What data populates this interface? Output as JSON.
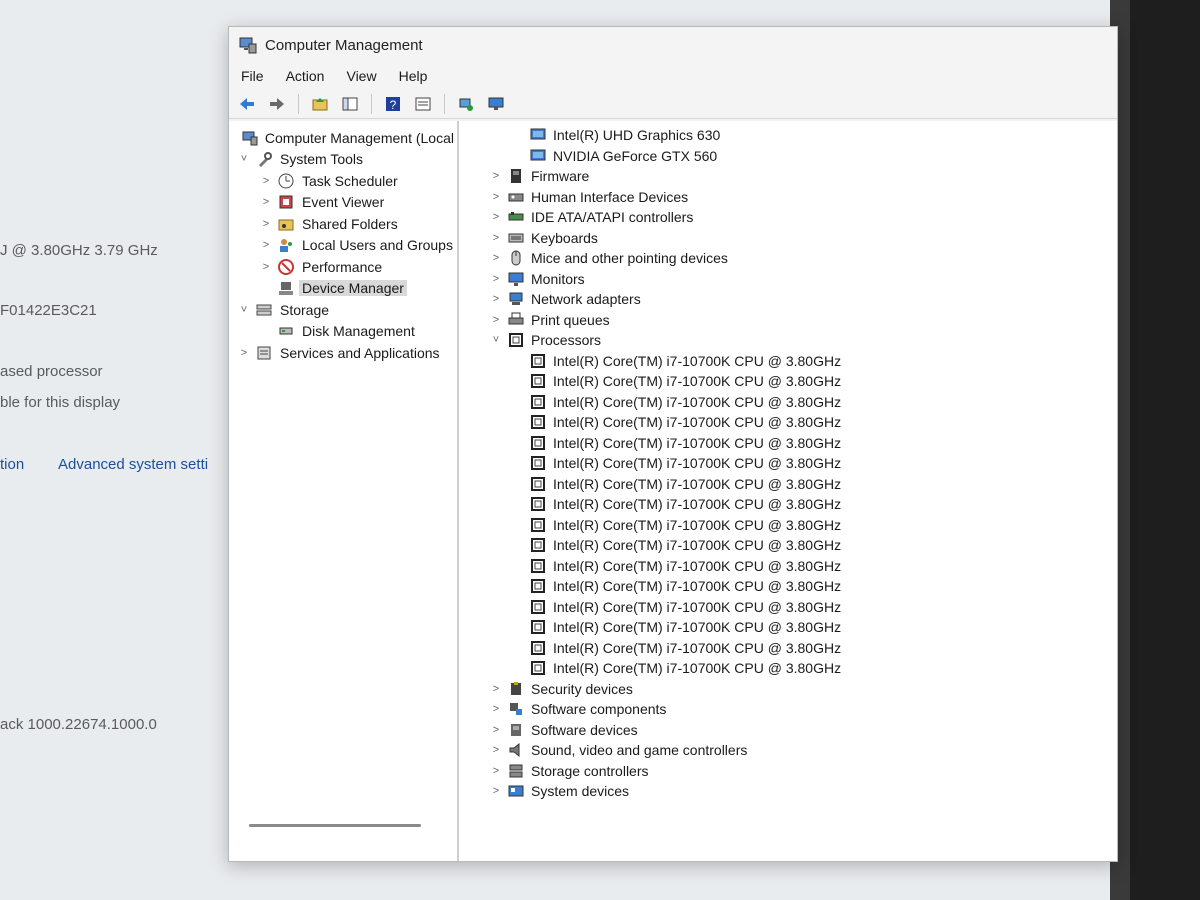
{
  "background_window": {
    "cpu_speed_text": "J @ 3.80GHz   3.79 GHz",
    "product_id_text": "F01422E3C21",
    "system_type_text": "ased processor",
    "pen_touch_text": "ble for this display",
    "links": [
      "tion",
      "Advanced system setti"
    ],
    "experience_pack_text": "ack 1000.22674.1000.0"
  },
  "window": {
    "title": "Computer Management",
    "menu": [
      "File",
      "Action",
      "View",
      "Help"
    ]
  },
  "toolbar": {
    "buttons": [
      "back-arrow-icon",
      "forward-arrow-icon",
      "up-folder-icon",
      "show-hide-tree-icon",
      "help-icon",
      "properties-icon",
      "scan-hardware-icon",
      "monitor-icon"
    ]
  },
  "left_tree": [
    {
      "label": "Computer Management (Local",
      "level": 0,
      "chevron": "",
      "icon": "computer-management-icon"
    },
    {
      "label": "System Tools",
      "level": 1,
      "chevron": "˅",
      "icon": "system-tools-icon"
    },
    {
      "label": "Task Scheduler",
      "level": 2,
      "chevron": ">",
      "icon": "task-scheduler-icon"
    },
    {
      "label": "Event Viewer",
      "level": 2,
      "chevron": ">",
      "icon": "event-viewer-icon"
    },
    {
      "label": "Shared Folders",
      "level": 2,
      "chevron": ">",
      "icon": "shared-folders-icon"
    },
    {
      "label": "Local Users and Groups",
      "level": 2,
      "chevron": ">",
      "icon": "local-users-icon"
    },
    {
      "label": "Performance",
      "level": 2,
      "chevron": ">",
      "icon": "performance-icon"
    },
    {
      "label": "Device Manager",
      "level": 2,
      "chevron": "",
      "icon": "device-manager-icon",
      "selected": true
    },
    {
      "label": "Storage",
      "level": 1,
      "chevron": "˅",
      "icon": "storage-icon"
    },
    {
      "label": "Disk Management",
      "level": 2,
      "chevron": "",
      "icon": "disk-management-icon"
    },
    {
      "label": "Services and Applications",
      "level": 1,
      "chevron": ">",
      "icon": "services-icon"
    }
  ],
  "device_tree": [
    {
      "label": "Intel(R) UHD Graphics 630",
      "level": 2,
      "chevron": "",
      "icon": "display-adapter-icon"
    },
    {
      "label": "NVIDIA GeForce GTX 560",
      "level": 2,
      "chevron": "",
      "icon": "display-adapter-icon"
    },
    {
      "label": "Firmware",
      "level": 1,
      "chevron": ">",
      "icon": "firmware-icon"
    },
    {
      "label": "Human Interface Devices",
      "level": 1,
      "chevron": ">",
      "icon": "hid-icon"
    },
    {
      "label": "IDE ATA/ATAPI controllers",
      "level": 1,
      "chevron": ">",
      "icon": "ide-controller-icon"
    },
    {
      "label": "Keyboards",
      "level": 1,
      "chevron": ">",
      "icon": "keyboard-icon"
    },
    {
      "label": "Mice and other pointing devices",
      "level": 1,
      "chevron": ">",
      "icon": "mouse-icon"
    },
    {
      "label": "Monitors",
      "level": 1,
      "chevron": ">",
      "icon": "monitor-icon"
    },
    {
      "label": "Network adapters",
      "level": 1,
      "chevron": ">",
      "icon": "network-adapter-icon"
    },
    {
      "label": "Print queues",
      "level": 1,
      "chevron": ">",
      "icon": "printer-icon"
    },
    {
      "label": "Processors",
      "level": 1,
      "chevron": "˅",
      "icon": "processor-icon"
    },
    {
      "label": "Intel(R) Core(TM) i7-10700K CPU @ 3.80GHz",
      "level": 2,
      "chevron": "",
      "icon": "processor-icon"
    },
    {
      "label": "Intel(R) Core(TM) i7-10700K CPU @ 3.80GHz",
      "level": 2,
      "chevron": "",
      "icon": "processor-icon"
    },
    {
      "label": "Intel(R) Core(TM) i7-10700K CPU @ 3.80GHz",
      "level": 2,
      "chevron": "",
      "icon": "processor-icon"
    },
    {
      "label": "Intel(R) Core(TM) i7-10700K CPU @ 3.80GHz",
      "level": 2,
      "chevron": "",
      "icon": "processor-icon"
    },
    {
      "label": "Intel(R) Core(TM) i7-10700K CPU @ 3.80GHz",
      "level": 2,
      "chevron": "",
      "icon": "processor-icon"
    },
    {
      "label": "Intel(R) Core(TM) i7-10700K CPU @ 3.80GHz",
      "level": 2,
      "chevron": "",
      "icon": "processor-icon"
    },
    {
      "label": "Intel(R) Core(TM) i7-10700K CPU @ 3.80GHz",
      "level": 2,
      "chevron": "",
      "icon": "processor-icon"
    },
    {
      "label": "Intel(R) Core(TM) i7-10700K CPU @ 3.80GHz",
      "level": 2,
      "chevron": "",
      "icon": "processor-icon"
    },
    {
      "label": "Intel(R) Core(TM) i7-10700K CPU @ 3.80GHz",
      "level": 2,
      "chevron": "",
      "icon": "processor-icon"
    },
    {
      "label": "Intel(R) Core(TM) i7-10700K CPU @ 3.80GHz",
      "level": 2,
      "chevron": "",
      "icon": "processor-icon"
    },
    {
      "label": "Intel(R) Core(TM) i7-10700K CPU @ 3.80GHz",
      "level": 2,
      "chevron": "",
      "icon": "processor-icon"
    },
    {
      "label": "Intel(R) Core(TM) i7-10700K CPU @ 3.80GHz",
      "level": 2,
      "chevron": "",
      "icon": "processor-icon"
    },
    {
      "label": "Intel(R) Core(TM) i7-10700K CPU @ 3.80GHz",
      "level": 2,
      "chevron": "",
      "icon": "processor-icon"
    },
    {
      "label": "Intel(R) Core(TM) i7-10700K CPU @ 3.80GHz",
      "level": 2,
      "chevron": "",
      "icon": "processor-icon"
    },
    {
      "label": "Intel(R) Core(TM) i7-10700K CPU @ 3.80GHz",
      "level": 2,
      "chevron": "",
      "icon": "processor-icon"
    },
    {
      "label": "Intel(R) Core(TM) i7-10700K CPU @ 3.80GHz",
      "level": 2,
      "chevron": "",
      "icon": "processor-icon"
    },
    {
      "label": "Security devices",
      "level": 1,
      "chevron": ">",
      "icon": "security-device-icon"
    },
    {
      "label": "Software components",
      "level": 1,
      "chevron": ">",
      "icon": "software-component-icon"
    },
    {
      "label": "Software devices",
      "level": 1,
      "chevron": ">",
      "icon": "software-device-icon"
    },
    {
      "label": "Sound, video and game controllers",
      "level": 1,
      "chevron": ">",
      "icon": "sound-icon"
    },
    {
      "label": "Storage controllers",
      "level": 1,
      "chevron": ">",
      "icon": "storage-controller-icon"
    },
    {
      "label": "System devices",
      "level": 1,
      "chevron": ">",
      "icon": "system-devices-icon"
    }
  ],
  "colors": {
    "selection": "#d9d9d9",
    "link": "#1c4f9c",
    "window_bg": "#f4f4f4"
  }
}
